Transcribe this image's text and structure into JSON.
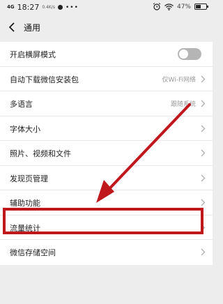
{
  "status_bar": {
    "network": "4G",
    "time": "18:27",
    "speed": "0.4K/s",
    "battery_pct": "47%",
    "battery_level": 0.47
  },
  "nav": {
    "title": "通用"
  },
  "settings": [
    {
      "label": "开启横屏模式",
      "type": "toggle",
      "on": false
    },
    {
      "label": "自动下载微信安装包",
      "type": "value",
      "value": "仅Wi-Fi网络"
    },
    {
      "label": "多语言",
      "type": "value",
      "value": "跟随系统"
    },
    {
      "label": "字体大小",
      "type": "link"
    },
    {
      "label": "照片、视频和文件",
      "type": "link"
    },
    {
      "label": "发现页管理",
      "type": "link"
    },
    {
      "label": "辅助功能",
      "type": "link"
    },
    {
      "label": "流量统计",
      "type": "link"
    },
    {
      "label": "微信存储空间",
      "type": "link"
    }
  ],
  "icons": {
    "back": "back-arrow-icon",
    "chevron": "chevron-right-icon",
    "wifi": "wifi-icon",
    "alarm": "alarm-icon",
    "battery": "battery-icon"
  },
  "colors": {
    "background": "#ededed",
    "annotation": "#c0171c",
    "toggle_off": "#b5b5b5"
  }
}
